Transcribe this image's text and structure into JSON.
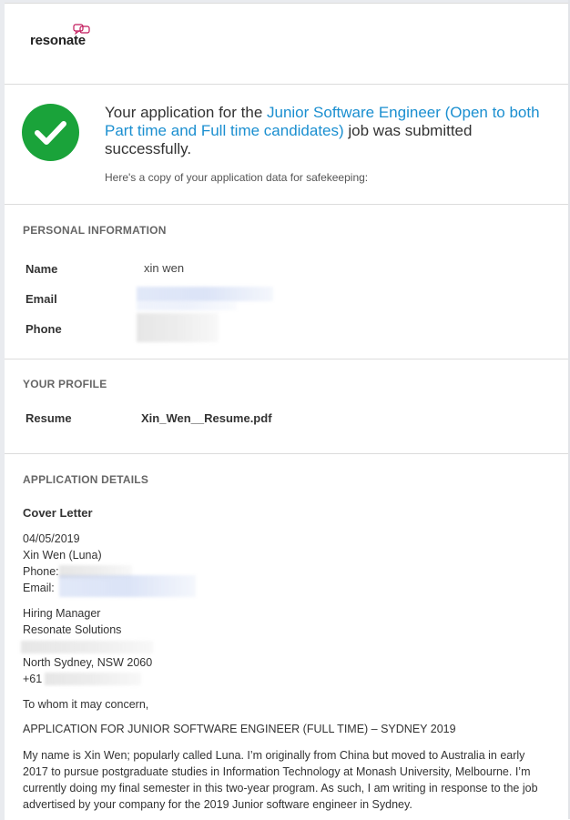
{
  "brand": {
    "name": "resonate"
  },
  "success": {
    "prefix": "Your application for the ",
    "job_title": "Junior Software Engineer (Open to both Part time and Full time candidates)",
    "suffix": " job was submitted successfully.",
    "copy_note": "Here's a copy of your application data for safekeeping:"
  },
  "personal": {
    "title": "PERSONAL INFORMATION",
    "name_label": "Name",
    "name_value": "xin wen",
    "email_label": "Email",
    "phone_label": "Phone"
  },
  "profile": {
    "title": "YOUR PROFILE",
    "resume_label": "Resume",
    "resume_file": "Xin_Wen__Resume.pdf"
  },
  "application": {
    "title": "APPLICATION DETAILS",
    "cover_letter_label": "Cover Letter",
    "lines": {
      "date": "04/05/2019",
      "sender": "Xin Wen (Luna)",
      "phone_prefix": "Phone: ",
      "email_prefix": "Email: ",
      "recipient": "Hiring Manager",
      "company": "Resonate Solutions",
      "city": "North Sydney, NSW 2060",
      "phone_code": "+61",
      "salutation": "To whom it may concern,",
      "subject": "APPLICATION FOR JUNIOR SOFTWARE ENGINEER (FULL TIME) – SYDNEY 2019",
      "body": "My name is Xin Wen; popularly called Luna. I’m originally from China but moved to Australia in early 2017 to pursue postgraduate studies in Information Technology at Monash University, Melbourne. I’m currently doing my final semester in this two-year program. As such, I am writing in response to the job advertised by your company for the 2019 Junior software engineer in Sydney."
    }
  },
  "colors": {
    "accent": "#1b8fd0",
    "success": "#1aa33a"
  },
  "icons": {
    "success": "checkmark-icon",
    "logo": "speech-bubbles-icon"
  }
}
